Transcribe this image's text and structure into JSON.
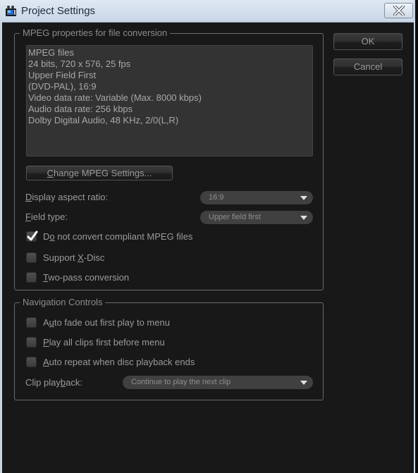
{
  "window": {
    "title": "Project Settings",
    "app_icon": "project-settings-app-icon",
    "close_icon": "close-icon"
  },
  "mpeg_group": {
    "label": "MPEG properties for file conversion",
    "info_lines": [
      "MPEG files",
      "24 bits, 720 x 576, 25 fps",
      "Upper Field First",
      "(DVD-PAL),  16:9",
      "Video data rate: Variable (Max.  8000 kbps)",
      "Audio data rate: 256 kbps",
      "Dolby Digital Audio, 48 KHz, 2/0(L,R)"
    ],
    "change_button": {
      "prefix": "",
      "accel": "C",
      "rest": "hange MPEG Settings..."
    },
    "display_aspect": {
      "label_accel": "D",
      "label_rest": "isplay aspect ratio:",
      "value": "16:9"
    },
    "field_type": {
      "label_accel": "F",
      "label_rest": "ield type:",
      "value": "Upper field first"
    },
    "checkboxes": [
      {
        "pre": "D",
        "accel": "o",
        "post": " not convert compliant MPEG files",
        "checked": true
      },
      {
        "pre": "Support ",
        "accel": "X",
        "post": "-Disc",
        "checked": false
      },
      {
        "pre": "",
        "accel": "T",
        "post": "wo-pass conversion",
        "checked": false
      }
    ]
  },
  "nav_group": {
    "label": "Navigation Controls",
    "checkboxes": [
      {
        "pre": "A",
        "accel": "u",
        "post": "to fade out first play to menu",
        "checked": false
      },
      {
        "pre": "",
        "accel": "P",
        "post": "lay all clips first before menu",
        "checked": false
      },
      {
        "pre": "",
        "accel": "A",
        "post": "uto repeat when disc playback ends",
        "checked": false
      }
    ],
    "clip_playback": {
      "label_pre": "Clip play",
      "label_accel": "b",
      "label_post": "ack:",
      "value": "Continue to play the next clip"
    }
  },
  "buttons": {
    "ok": "OK",
    "cancel": "Cancel"
  }
}
